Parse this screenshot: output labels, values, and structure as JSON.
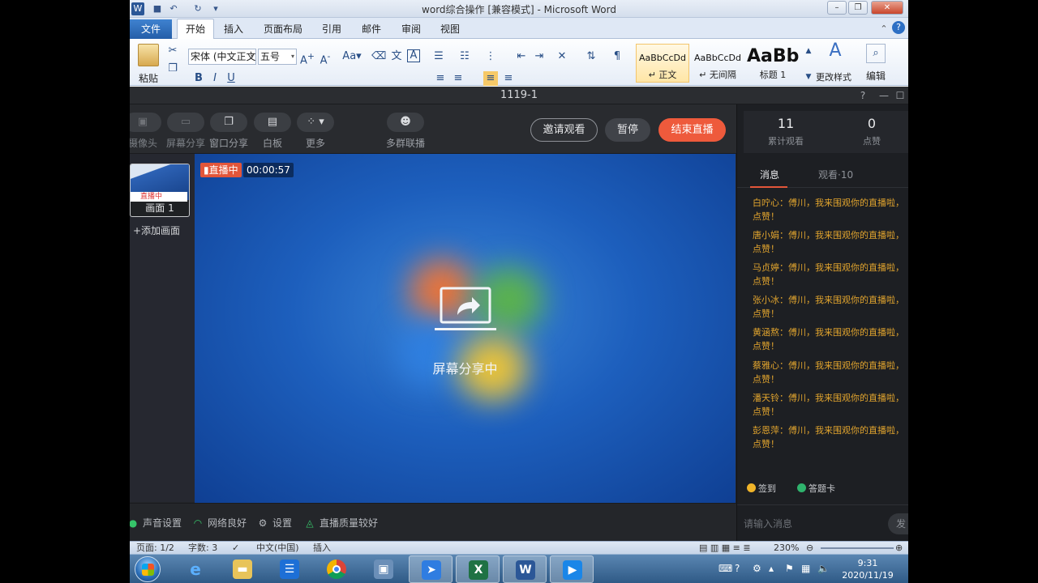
{
  "word": {
    "title": "word综合操作 [兼容模式] - Microsoft Word",
    "tabs": [
      "开始",
      "插入",
      "页面布局",
      "引用",
      "邮件",
      "审阅",
      "视图"
    ],
    "file_tab": "文件",
    "paste_label": "粘贴",
    "font_name": "宋体 (中文正文)",
    "font_size": "五号",
    "styles": [
      {
        "sample": "AaBbCcDd",
        "name": "↵ 正文"
      },
      {
        "sample": "AaBbCcDd",
        "name": "↵ 无间隔"
      },
      {
        "sample": "AaBb",
        "name": "标题 1"
      }
    ],
    "change_styles": "更改样式",
    "edit_label": "编辑",
    "status": {
      "page": "页面: 1/2",
      "words": "字数: 3",
      "language": "中文(中国)",
      "insert_mode": "插入",
      "zoom": "230%"
    }
  },
  "live": {
    "title": "1119-1",
    "toolbar": [
      {
        "icon": "camera-icon",
        "label": "摄像头"
      },
      {
        "icon": "screen-share-icon",
        "label": "屏幕分享"
      },
      {
        "icon": "window-share-icon",
        "label": "窗口分享"
      },
      {
        "icon": "whiteboard-icon",
        "label": "白板"
      },
      {
        "icon": "grid-icon",
        "label": "更多"
      },
      {
        "icon": "multi-group-icon",
        "label": "多群联播"
      }
    ],
    "buttons": {
      "invite": "邀请观看",
      "pause": "暂停",
      "end": "结束直播"
    },
    "scene": {
      "live_mini": "直播中",
      "name": "画面 1",
      "add": "+添加画面"
    },
    "badge": "直播中",
    "timer": "00:00:57",
    "sharing_label": "屏幕分享中",
    "status": {
      "audio": "声音设置",
      "network": "网络良好",
      "settings": "设置",
      "quality": "直播质量较好"
    },
    "stats": {
      "views_count": "11",
      "views_label": "累计观看",
      "likes_count": "0",
      "likes_label": "点赞"
    },
    "side_tabs": {
      "messages": "消息",
      "viewers": "观看·10"
    },
    "messages": [
      {
        "l1": "白咛心：傅川，我来围观你的直播啦，",
        "l2": "点赞！"
      },
      {
        "l1": "唐小娟：傅川，我来围观你的直播啦，",
        "l2": "点赞！"
      },
      {
        "l1": "马贞婷：傅川，我来围观你的直播啦，",
        "l2": "点赞！"
      },
      {
        "l1": "张小冰：傅川，我来围观你的直播啦，",
        "l2": "点赞！"
      },
      {
        "l1": "黄涵熬：傅川，我来围观你的直播啦，",
        "l2": "点赞！"
      },
      {
        "l1": "蔡雅心：傅川，我来围观你的直播啦，",
        "l2": "点赞！"
      },
      {
        "l1": "潘天铃：傅川，我来围观你的直播啦，",
        "l2": "点赞！"
      },
      {
        "l1": "彭恩萍：傅川，我来围观你的直播啦，",
        "l2": "点赞！"
      }
    ],
    "quick": {
      "checkin": "签到",
      "answer": "答题卡"
    },
    "input_placeholder": "请输入消息",
    "send": "发"
  },
  "taskbar": {
    "time": "9:31",
    "date": "2020/11/19"
  },
  "colors": {
    "live_red": "#ee5a3c",
    "message_orange": "#e1a42e",
    "panel_bg": "#232529"
  }
}
